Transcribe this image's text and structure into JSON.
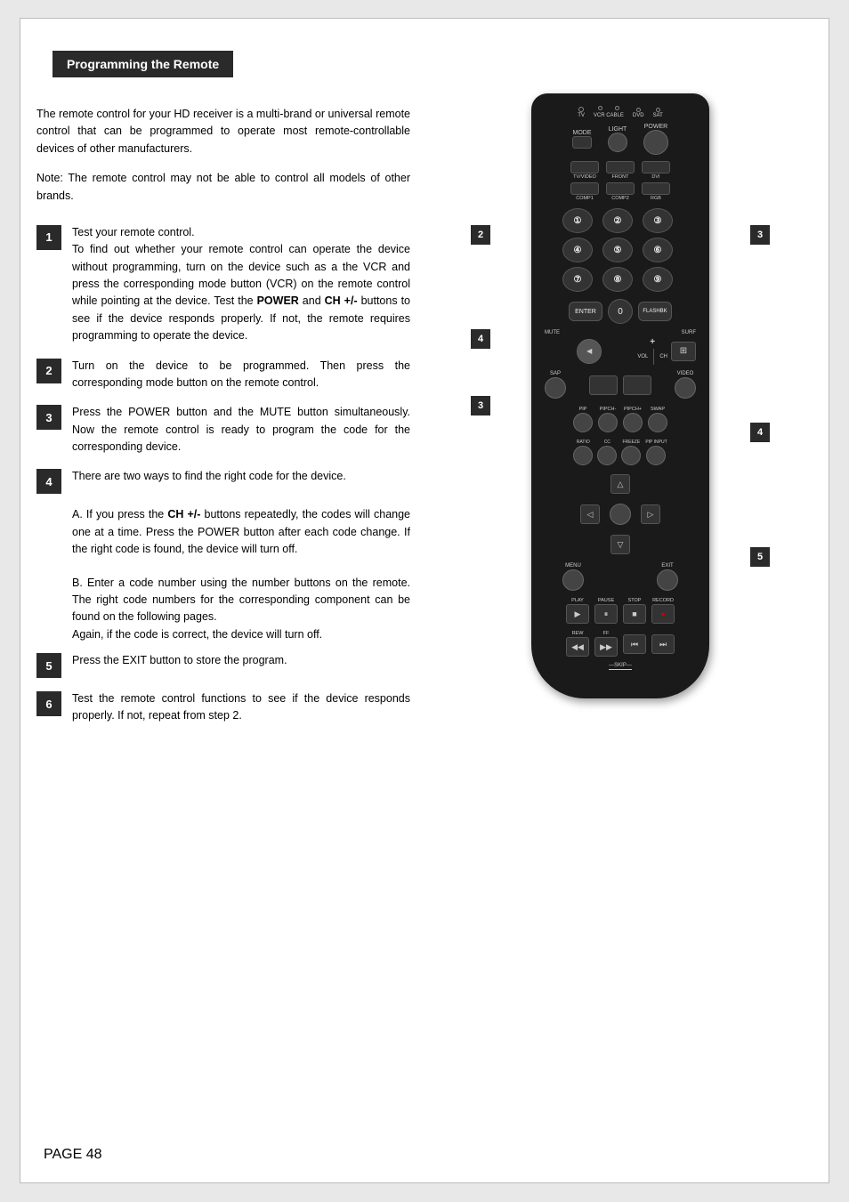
{
  "page": {
    "title": "Programming the Remote",
    "page_number": "PAGE  48"
  },
  "intro": {
    "paragraph1": "The remote control for your HD receiver is a multi-brand or universal remote control that can be programmed to operate most remote-controllable devices of other manufacturers.",
    "note": "Note: The remote control may not be able to control all models of other brands."
  },
  "steps": [
    {
      "number": "1",
      "text": "Test your remote control.\nTo find out whether your remote control can operate the device without programming, turn on the device such as a the VCR and press the corresponding mode button (VCR) on the remote control while pointing at the device. Test the POWER and CH +/- buttons to see if the device responds properly. If not, the remote requires programming to operate the device."
    },
    {
      "number": "2",
      "text": "Turn on the device to be programmed. Then press the corresponding mode button on the remote control."
    },
    {
      "number": "3",
      "text": "Press the POWER button and the MUTE button simultaneously. Now the remote control is ready to program the code for the corresponding device."
    },
    {
      "number": "4",
      "text_a": "There are two ways to find the right code for the device.",
      "text_b": "A. If  you press the CH +/- buttons repeatedly, the codes will change one at a time. Press the POWER button after each code change. If the right code is found, the device will turn off.",
      "text_c": "B. Enter a code number using the number buttons on the remote. The right code numbers for the corresponding component can be found on the following pages.\nAgain, if the code is correct, the device will turn off."
    },
    {
      "number": "5",
      "text": "Press the EXIT button to store the program."
    },
    {
      "number": "6",
      "text": "Test the remote control functions to see if the device responds properly. If not, repeat from step 2."
    }
  ],
  "remote": {
    "callouts": [
      {
        "id": "2",
        "position": "top_left"
      },
      {
        "id": "3",
        "position": "top_right"
      },
      {
        "id": "4",
        "position": "middle_left"
      },
      {
        "id": "3",
        "position": "middle_right_low"
      },
      {
        "id": "4",
        "position": "right_middle"
      },
      {
        "id": "5",
        "position": "right_lower"
      }
    ],
    "indicator_labels": [
      "TV",
      "VCR",
      "CABLE",
      "DVD",
      "SAT"
    ],
    "mode_label": "MODE",
    "light_label": "LIGHT",
    "power_label": "POWER",
    "input_labels": [
      "TV/VIDEO",
      "FRONT",
      "DVI",
      "COMP1",
      "COMP2",
      "RGB"
    ],
    "numbers": [
      "1",
      "2",
      "3",
      "4",
      "5",
      "6",
      "7",
      "8",
      "9",
      "ENTER",
      "0",
      "FLASHBK"
    ],
    "mute_label": "MUTE",
    "surf_label": "SURF",
    "vol_label": "VOL",
    "ch_label": "CH",
    "sap_label": "SAP",
    "video_label": "VIDEO",
    "pip_labels": [
      "PIP",
      "PIPCH-",
      "PIPCH+",
      "SWAP"
    ],
    "ratio_labels": [
      "RATIO",
      "CC",
      "FREEZE",
      "PIP INPUT"
    ],
    "menu_label": "MENU",
    "exit_label": "EXIT",
    "transport_labels": [
      "PLAY",
      "PAUSE",
      "STOP",
      "RECORD"
    ],
    "skip_labels": [
      "REW",
      "FF",
      "",
      ""
    ],
    "skip_text": "—SKIP—"
  }
}
